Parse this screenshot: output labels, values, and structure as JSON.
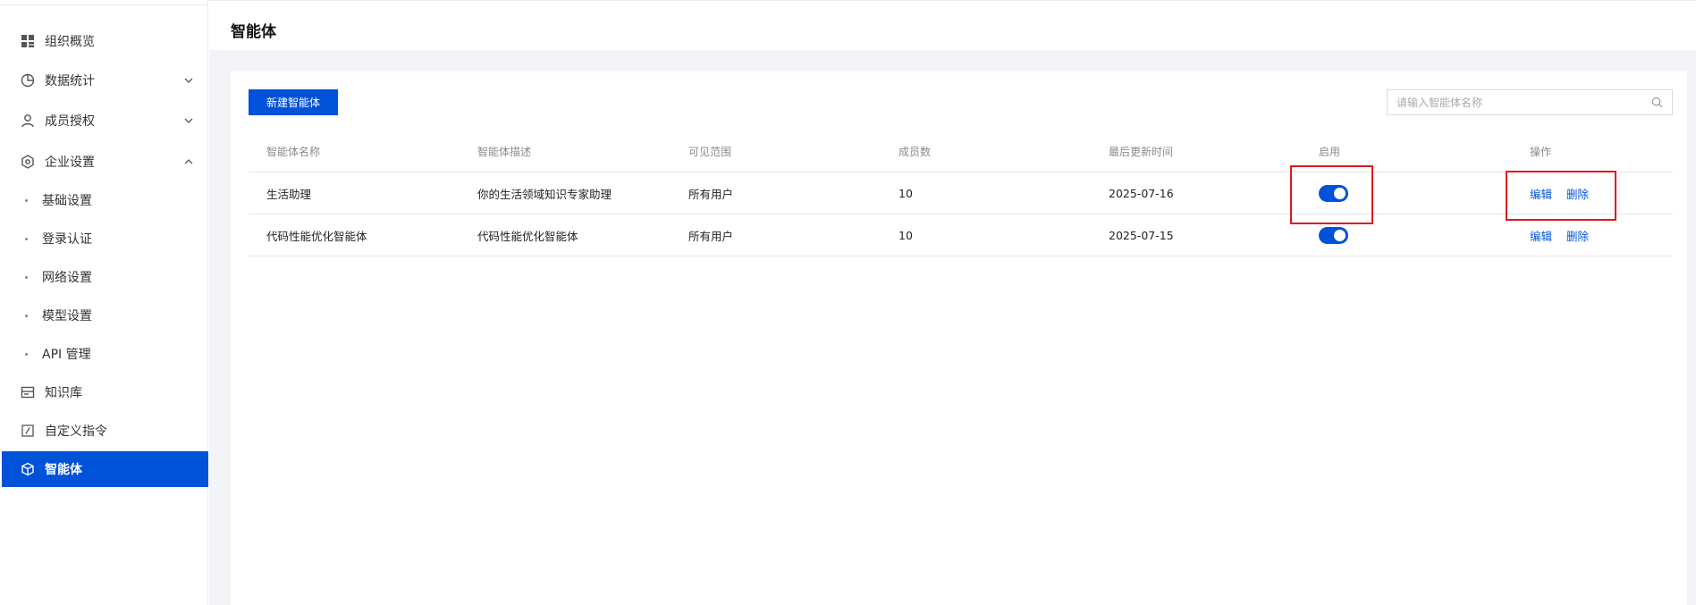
{
  "header": {
    "title": "智能体"
  },
  "sidebar": {
    "items": [
      {
        "label": "组织概览",
        "icon": "grid-icon"
      },
      {
        "label": "数据统计",
        "icon": "pie-chart-icon"
      },
      {
        "label": "成员授权",
        "icon": "user-icon"
      },
      {
        "label": "企业设置",
        "icon": "settings-icon"
      },
      {
        "label": "知识库",
        "icon": "database-icon"
      },
      {
        "label": "自定义指令",
        "icon": "command-icon"
      },
      {
        "label": "智能体",
        "icon": "cube-icon"
      }
    ],
    "sub_items": [
      {
        "label": "基础设置"
      },
      {
        "label": "登录认证"
      },
      {
        "label": "网络设置"
      },
      {
        "label": "模型设置"
      },
      {
        "label": "API 管理"
      }
    ]
  },
  "toolbar": {
    "new_label": "新建智能体"
  },
  "search": {
    "placeholder": "请输入智能体名称"
  },
  "table": {
    "columns": [
      "智能体名称",
      "智能体描述",
      "可见范围",
      "成员数",
      "最后更新时间",
      "启用",
      "操作"
    ],
    "rows": [
      {
        "name": "生活助理",
        "desc": "你的生活领域知识专家助理",
        "scope": "所有用户",
        "members": "10",
        "updated": "2025-07-16",
        "enabled": true,
        "edit": "编辑",
        "delete": "删除"
      },
      {
        "name": "代码性能优化智能体",
        "desc": "代码性能优化智能体",
        "scope": "所有用户",
        "members": "10",
        "updated": "2025-07-15",
        "enabled": true,
        "edit": "编辑",
        "delete": "删除"
      }
    ]
  },
  "colors": {
    "accent": "#0052d9",
    "highlight": "#e3141c"
  }
}
